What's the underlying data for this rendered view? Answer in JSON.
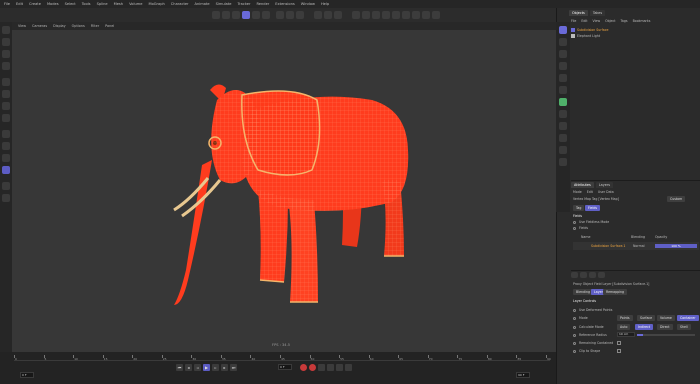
{
  "menu": [
    "File",
    "Edit",
    "Create",
    "Modes",
    "Select",
    "Tools",
    "Spline",
    "Mesh",
    "Volume",
    "MoGraph",
    "Character",
    "Animate",
    "Simulate",
    "Tracker",
    "Render",
    "Extensions",
    "Window",
    "Help"
  ],
  "viewport": {
    "menu": [
      "View",
      "Cameras",
      "Display",
      "Options",
      "Filter",
      "Panel"
    ],
    "fps_label": "FPS : 34.5"
  },
  "timeline": {
    "ticks": [
      "0",
      "5",
      "10",
      "15",
      "20",
      "25",
      "30",
      "35",
      "40",
      "45",
      "50",
      "55",
      "60",
      "65",
      "70",
      "75",
      "80",
      "85",
      "90"
    ],
    "start_frame": "0 F",
    "end_frame": "90 F",
    "current_frame": "0 F"
  },
  "objects_panel": {
    "tabs": [
      "Objects",
      "Takes"
    ],
    "menu": [
      "File",
      "Edit",
      "View",
      "Object",
      "Tags",
      "Bookmarks"
    ],
    "items": [
      {
        "name": "Subdivision Surface",
        "color": "#f0a640"
      },
      {
        "name": "Elephant Light",
        "color": "#bdbdbd"
      }
    ]
  },
  "attributes_panel": {
    "tabs": [
      "Attributes",
      "Layers"
    ],
    "menu": [
      "Mode",
      "Edit",
      "User Data"
    ],
    "object_line": "Vertex Map Tag [Vertex Map]",
    "mode_label": "Custom",
    "subtabs": [
      "Tag",
      "Fields"
    ],
    "section_title": "Fields",
    "use_falloff": "Use Fieldless Mode",
    "fields_label": "Fields",
    "table_headers": [
      "Name",
      "Blending",
      "Opacity"
    ],
    "field_row": {
      "name": "Subdivision Surface.1",
      "blending": "Normal",
      "opacity": "100 %"
    },
    "lower_object_line": "Proxy Object Field Layer [Subdivision Surface.1]",
    "lower_tabs": [
      "Blending",
      "Layer",
      "Remapping"
    ],
    "layer_controls": "Layer Controls",
    "rows": [
      {
        "label": "Use Deformed Points",
        "value": ""
      },
      {
        "label": "Mode",
        "options": [
          "Points",
          "Surface",
          "Volume",
          "Container"
        ],
        "active": 3
      },
      {
        "label": "Calculate Mode",
        "options": [
          "Auto",
          "Indirect",
          "Direct",
          "Shell"
        ],
        "active": 1
      },
      {
        "label": "Reference Radius",
        "value": "10 cm"
      },
      {
        "label": "Remaining Contained",
        "value": ""
      },
      {
        "label": "Clip to Shape",
        "value": ""
      }
    ]
  },
  "colors": {
    "model": "#ff3c1e",
    "accent": "#6a6ad8",
    "record": "#c83a3a"
  }
}
